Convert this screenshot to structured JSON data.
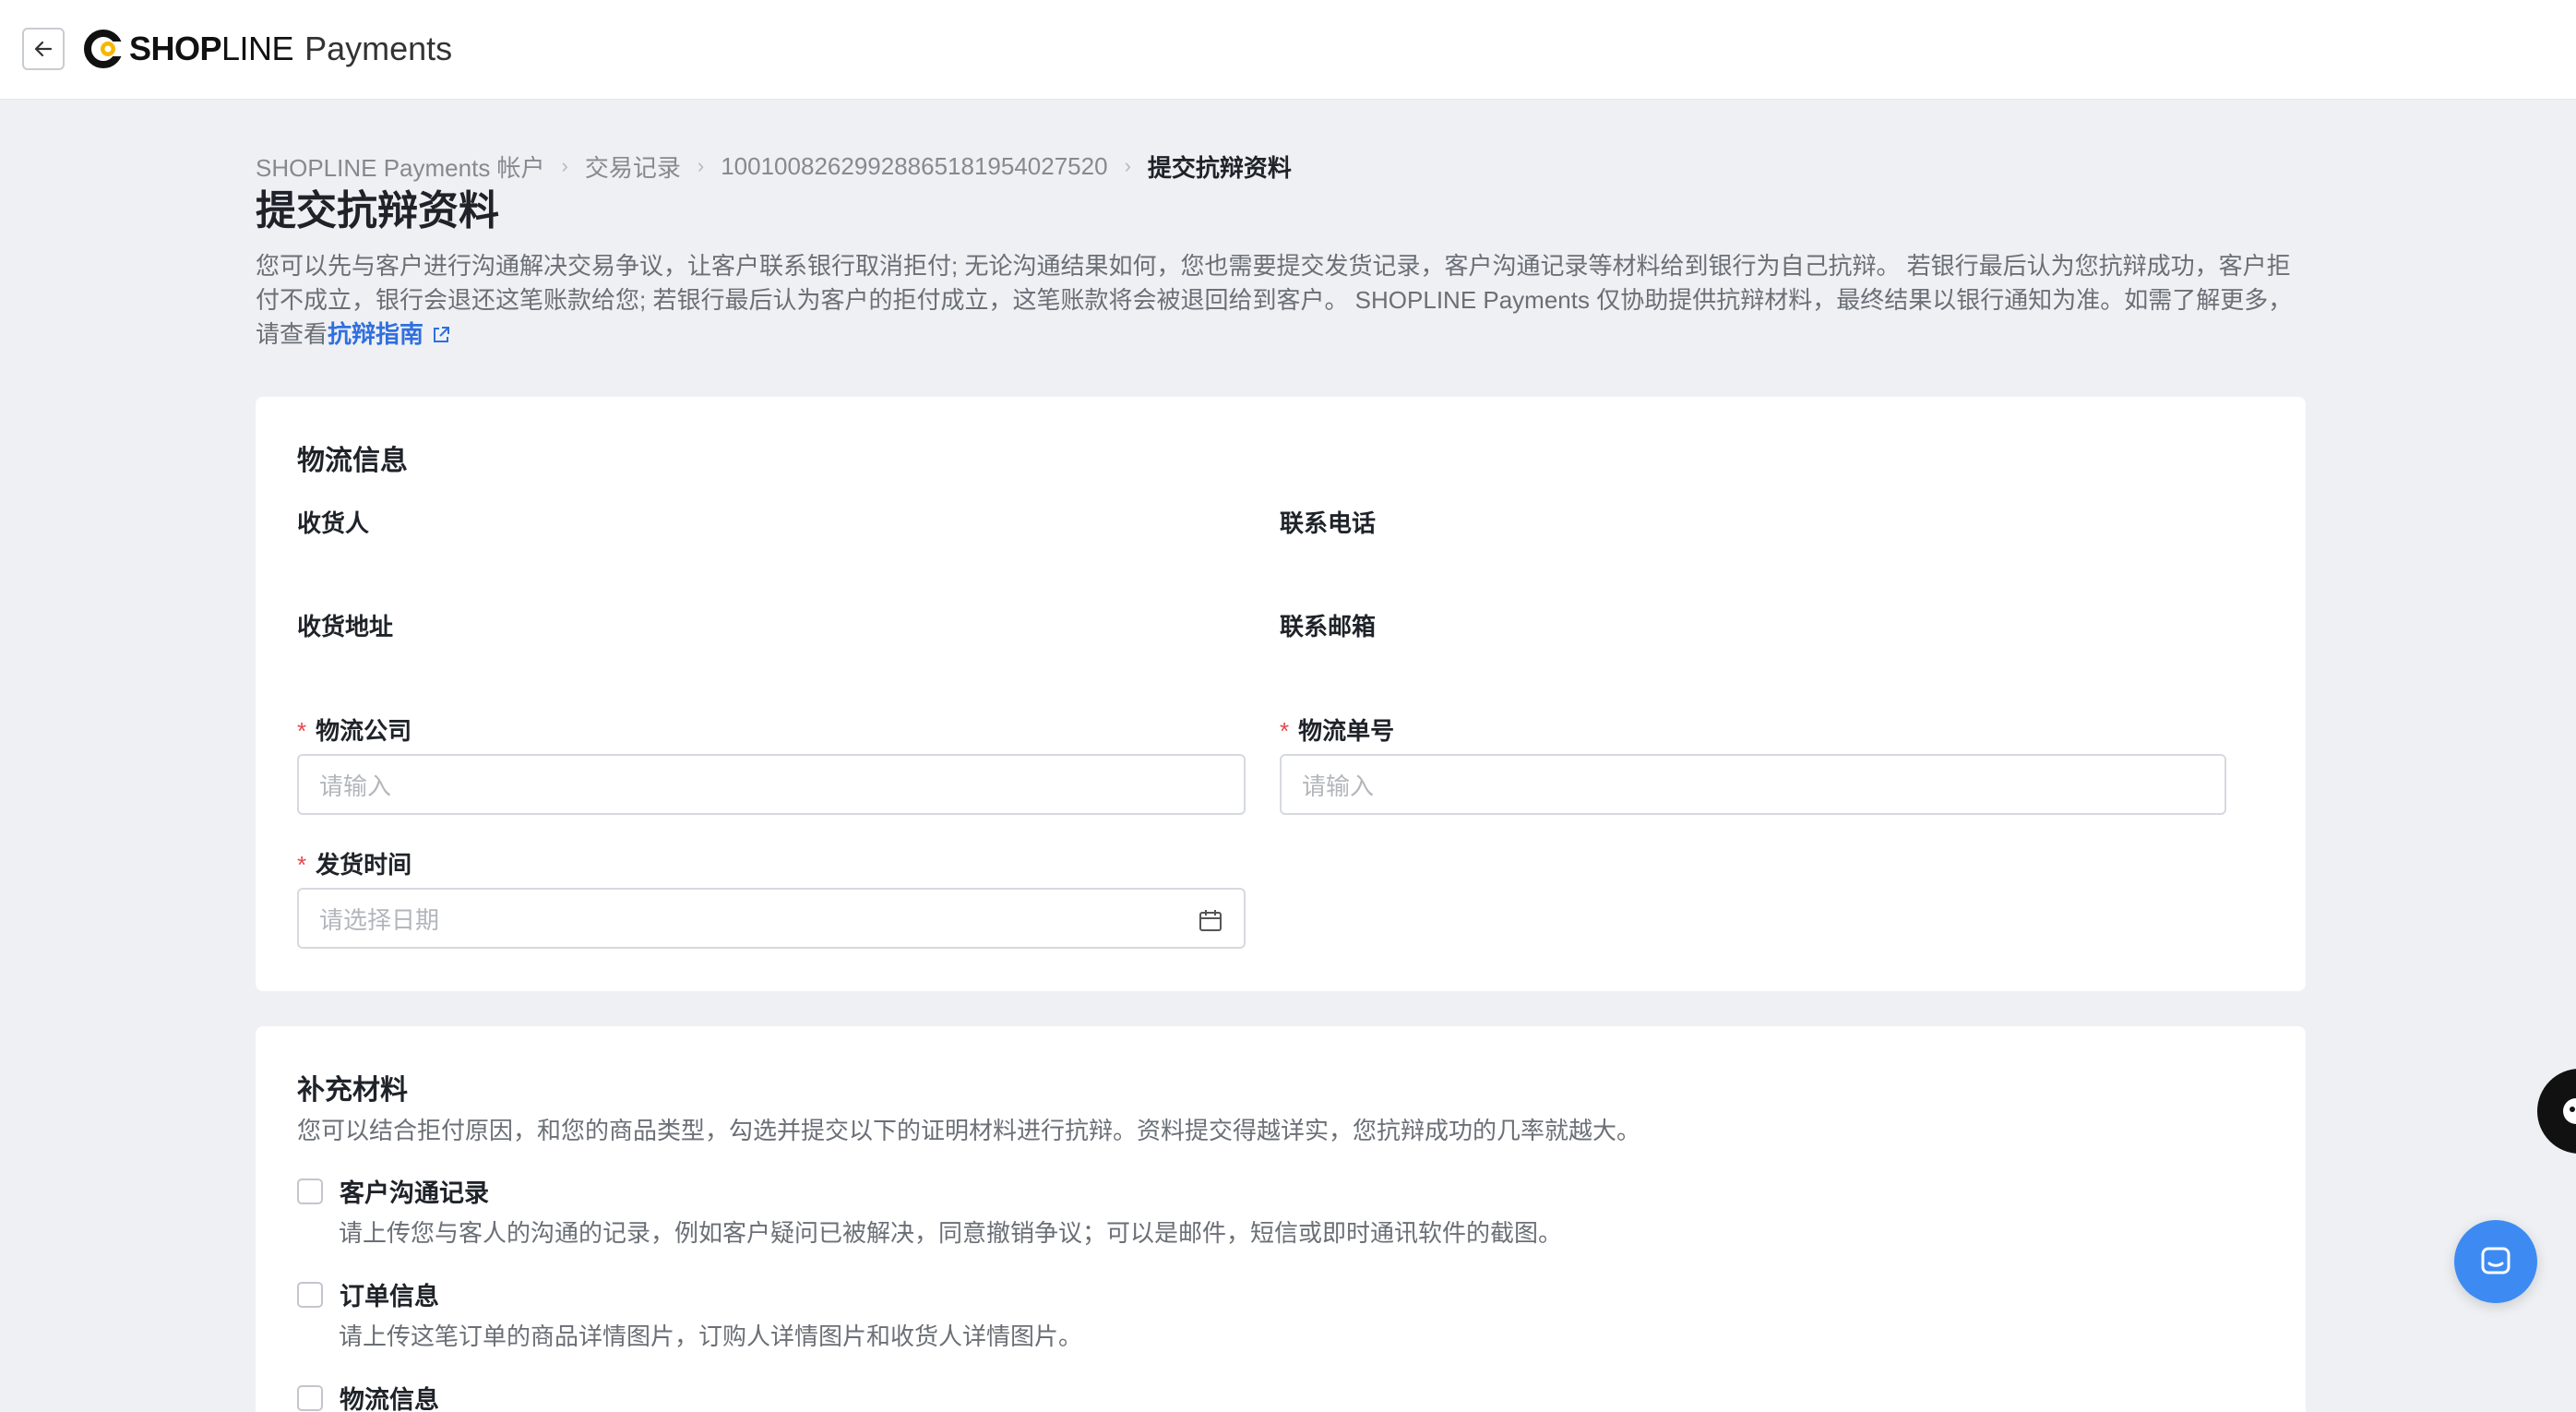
{
  "topbar": {
    "logo_bold": "SHOP",
    "logo_light": "LINE",
    "logo_product": "Payments",
    "back_icon": "arrow-left-icon"
  },
  "breadcrumb": [
    "SHOPLINE Payments 帐户",
    "交易记录",
    "1001008262992886518195402752​0",
    "提交抗辩资料"
  ],
  "page": {
    "title": "提交抗辩资料",
    "intro_text": "您可以先与客户进行沟通解决交易争议，让客户联系银行取消拒付; 无论沟通结果如何，您也需要提交发货记录，客户沟通记录等材料给到银行为自己抗辩。 若银行最后认为您抗辩成功，客户拒付不成立，银行会退还这笔账款给您; 若银行最后认为客户的拒付成立，这笔账款将会被退回给到客户。 SHOPLINE Payments 仅协助提供抗辩材料，最终结果以银行通知为准。如需了解更多，请查看",
    "intro_link": "抗辩指南"
  },
  "logistics": {
    "title": "物流信息",
    "recipient_label": "收货人",
    "phone_label": "联系电话",
    "address_label": "收货地址",
    "email_label": "联系邮箱",
    "company_label": "物流公司",
    "company_placeholder": "请输入",
    "tracking_label": "物流单号",
    "tracking_placeholder": "请输入",
    "ship_date_label": "发货时间",
    "ship_date_placeholder": "请选择日期",
    "required_mark": "*"
  },
  "supplement": {
    "title": "补充材料",
    "description": "您可以结合拒付原因，和您的商品类型，勾选并提交以下的证明材料进行抗辩。资料提交得越详实，您抗辩成功的几率就越大。",
    "items": [
      {
        "label": "客户沟通记录",
        "desc": "请上传您与客人的沟通的记录，例如客户疑问已被解决，同意撤销争议；可以是邮件，短信或即时通讯软件的截图。"
      },
      {
        "label": "订单信息",
        "desc": "请上传这笔订单的商品详情图片，订购人详情图片和收货人详情图片。"
      },
      {
        "label": "物流信息",
        "desc": ""
      }
    ]
  },
  "colors": {
    "accent": "#2f6fe0",
    "required": "#e5484d",
    "chat": "#3d8bf2",
    "page_bg": "#eef0f3"
  }
}
